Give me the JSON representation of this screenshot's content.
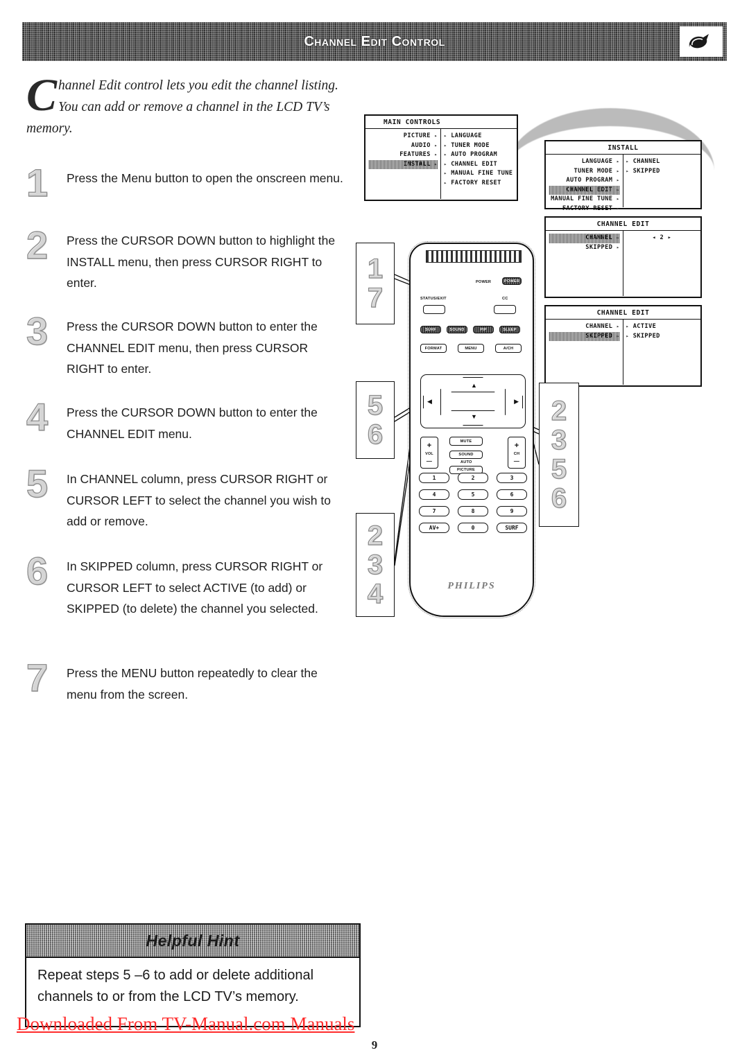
{
  "header": {
    "title": "Channel Edit Control",
    "logo_icon": "swoosh-logo-icon"
  },
  "intro": {
    "dropcap": "C",
    "text": "hannel Edit control lets you edit the channel listing. You can add or remove a channel in the LCD TV’s memory."
  },
  "steps": [
    {
      "number": "1",
      "text": "Press the Menu button to open the onscreen menu."
    },
    {
      "number": "2",
      "text": "Press the CURSOR DOWN button to highlight the INSTALL menu, then press CURSOR RIGHT to enter."
    },
    {
      "number": "3",
      "text": "Press the CURSOR DOWN button to enter the CHANNEL EDIT menu, then press CURSOR RIGHT to enter."
    },
    {
      "number": "4",
      "text": "Press the CURSOR DOWN button to enter the CHANNEL EDIT menu."
    },
    {
      "number": "5",
      "text": "In CHANNEL column, press CURSOR RIGHT or CURSOR LEFT to select the channel you wish to add or remove."
    },
    {
      "number": "6",
      "text": "In SKIPPED column, press CURSOR RIGHT or CURSOR LEFT to select ACTIVE (to add) or SKIPPED (to delete) the channel you selected."
    },
    {
      "number": "7",
      "text": "Press the MENU button repeatedly to clear the menu from the screen."
    }
  ],
  "osd": {
    "main_controls": {
      "title": "MAIN CONTROLS",
      "left": [
        {
          "label": "PICTURE",
          "arrow": "▸",
          "highlighted": false
        },
        {
          "label": "AUDIO",
          "arrow": "▸",
          "highlighted": false
        },
        {
          "label": "FEATURES",
          "arrow": "▸",
          "highlighted": false
        },
        {
          "label": "INSTALL",
          "arrow": "▸",
          "highlighted": true
        }
      ],
      "right": [
        {
          "label": "LANGUAGE",
          "arrow": "▸"
        },
        {
          "label": "TUNER MODE",
          "arrow": "▸"
        },
        {
          "label": "AUTO PROGRAM",
          "arrow": "▸"
        },
        {
          "label": "CHANNEL EDIT",
          "arrow": "▸"
        },
        {
          "label": "MANUAL FINE TUNE",
          "arrow": "▸"
        },
        {
          "label": "FACTORY RESET",
          "arrow": "▸"
        }
      ]
    },
    "install": {
      "title": "INSTALL",
      "left": [
        {
          "label": "LANGUAGE",
          "arrow": "▸",
          "highlighted": false
        },
        {
          "label": "TUNER MODE",
          "arrow": "▸",
          "highlighted": false
        },
        {
          "label": "AUTO PROGRAM",
          "arrow": "▸",
          "highlighted": false
        },
        {
          "label": "CHANNEL EDIT",
          "arrow": "▸",
          "highlighted": true
        },
        {
          "label": "MANUAL FINE TUNE",
          "arrow": "▸",
          "highlighted": false
        },
        {
          "label": "FACTORY RESET",
          "arrow": "▸",
          "highlighted": false
        }
      ],
      "right": [
        {
          "label": "CHANNEL",
          "arrow": "▸"
        },
        {
          "label": "SKIPPED",
          "arrow": "▸"
        }
      ]
    },
    "channel_edit_channel": {
      "title": "CHANNEL EDIT",
      "left": [
        {
          "label": "CHANNEL",
          "arrow": "▸",
          "highlighted": true
        },
        {
          "label": "SKIPPED",
          "arrow": "▸",
          "highlighted": false
        }
      ],
      "right_value": "◂    2    ▸"
    },
    "channel_edit_skipped": {
      "title": "CHANNEL EDIT",
      "left": [
        {
          "label": "CHANNEL",
          "arrow": "▸",
          "highlighted": false
        },
        {
          "label": "SKIPPED",
          "arrow": "▸",
          "highlighted": true
        }
      ],
      "right": [
        {
          "label": "ACTIVE",
          "arrow": "▸"
        },
        {
          "label": "SKIPPED",
          "arrow": "▸"
        }
      ]
    }
  },
  "remote": {
    "brand": "PHILIPS",
    "power_label": "POWER",
    "power_button": "POWER",
    "status_label": "STATUS/EXIT",
    "cc_label": "CC",
    "dark_buttons": [
      "SURF",
      "SOUND",
      "PIP",
      "SLEEP"
    ],
    "row_buttons": [
      "FORMAT",
      "MENU",
      "A/CH"
    ],
    "vol_label": "VOL",
    "vol_plus": "+",
    "vol_minus": "—",
    "ch_label": "CH",
    "ch_plus": "+",
    "ch_minus": "—",
    "mute": "MUTE",
    "sound": "SOUND",
    "auto": "AUTO",
    "picture": "PICTURE",
    "cursor_up": "▲",
    "cursor_down": "▼",
    "cursor_left": "◀",
    "cursor_right": "▶",
    "keypad": [
      [
        "1",
        "2",
        "3"
      ],
      [
        "4",
        "5",
        "6"
      ],
      [
        "7",
        "8",
        "9"
      ],
      [
        "AV+",
        "0",
        "SURF"
      ]
    ]
  },
  "callouts": {
    "menu_button": [
      "1",
      "7"
    ],
    "cursor_left_right": [
      "5",
      "6"
    ],
    "cursor_down": [
      "2",
      "3",
      "4"
    ],
    "cursor_right": [
      "2",
      "3",
      "5",
      "6"
    ]
  },
  "hint": {
    "title": "Helpful Hint",
    "body": "Repeat steps 5 –6 to add or delete additional channels to or from the LCD TV’s memory."
  },
  "footer": {
    "watermark": "Downloaded From TV-Manual.com Manuals",
    "page_number": "9"
  },
  "colors": {
    "watermark_red": "#ff2b2b",
    "banner_dark": "#3b3b3b",
    "hint_header_gray": "#9e9e9e"
  }
}
